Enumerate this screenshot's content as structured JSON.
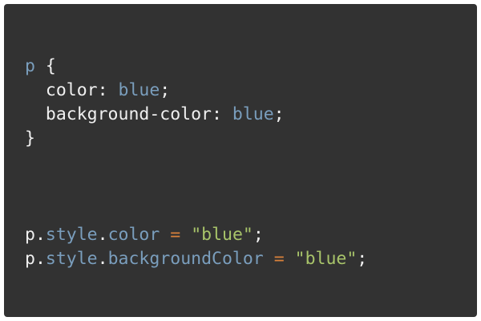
{
  "css": {
    "selector": "p",
    "open_brace": "{",
    "close_brace": "}",
    "declarations": [
      {
        "property": "color",
        "value": "blue"
      },
      {
        "property": "background-color",
        "value": "blue"
      }
    ]
  },
  "js": {
    "lines": [
      {
        "object": "p",
        "member1": "style",
        "member2": "color",
        "operator": "=",
        "string": "\"blue\""
      },
      {
        "object": "p",
        "member1": "style",
        "member2": "backgroundColor",
        "operator": "=",
        "string": "\"blue\""
      }
    ]
  },
  "colors": {
    "panel_background": "#323232",
    "keyword_blue": "#7a9ebd",
    "operator_orange": "#d9813b",
    "string_green": "#a8c46a",
    "text_white": "#f0f0f0"
  }
}
